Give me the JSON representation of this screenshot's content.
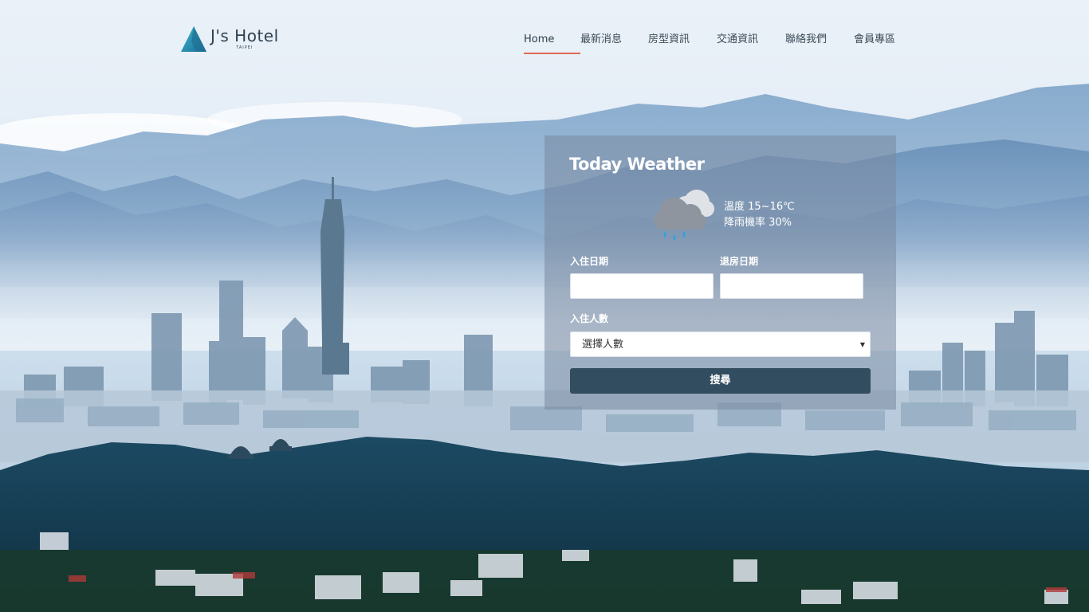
{
  "brand": {
    "name": "J's Hotel",
    "subtitle": "TAIPEI",
    "accent_color": "#2a9bb3"
  },
  "nav": {
    "items": [
      {
        "label": "Home",
        "active": true
      },
      {
        "label": "最新消息",
        "active": false
      },
      {
        "label": "房型資訊",
        "active": false
      },
      {
        "label": "交通資訊",
        "active": false
      },
      {
        "label": "聯絡我們",
        "active": false
      },
      {
        "label": "會員專區",
        "active": false
      }
    ],
    "active_underline_color": "#e0685c"
  },
  "weather": {
    "title": "Today Weather",
    "icon": "rain-cloud-icon",
    "temperature": "溫度 15~16℃",
    "rain_chance": "降雨機率 30%"
  },
  "booking": {
    "checkin_label": "入住日期",
    "checkin_value": "",
    "checkout_label": "退房日期",
    "checkout_value": "",
    "guests_label": "入住人數",
    "guests_selected": "選擇人數",
    "search_label": "搜尋",
    "button_color": "#334d60"
  }
}
